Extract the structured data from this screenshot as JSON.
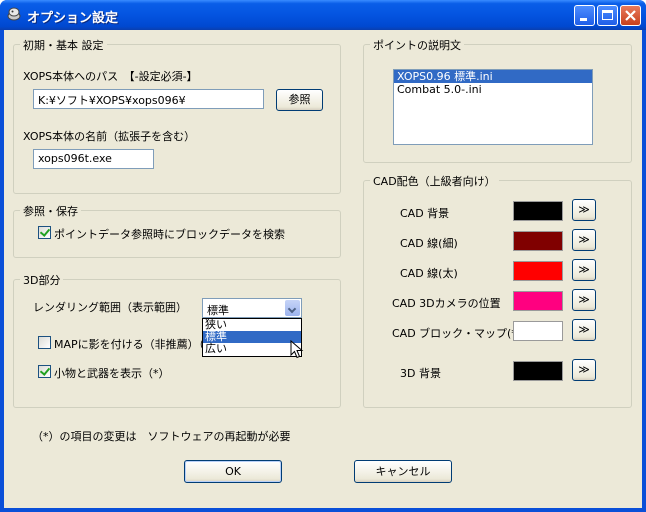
{
  "window": {
    "title": "オプション設定"
  },
  "groups": {
    "basic": {
      "title": "初期・基本 設定",
      "path_label": "XOPS本体へのパス　【-設定必須-】",
      "path_value": "K:¥ソフト¥XOPS¥xops096¥",
      "browse_button": "参照",
      "name_label": "XOPS本体の名前（拡張子を含む）",
      "name_value": "xops096t.exe"
    },
    "reference": {
      "title": "参照・保存",
      "search_block_label": "ポイントデータ参照時にブロックデータを検索",
      "search_block_checked": true
    },
    "threed": {
      "title": "3D部分",
      "range_label": "レンダリング範囲（表示範囲）",
      "range_selected": "標準",
      "range_options": [
        "狭い",
        "標準",
        "広い"
      ],
      "range_highlight": "標準",
      "shadow_label": "MAPに影を付ける（非推薦）（",
      "shadow_checked": false,
      "show_items_label": "小物と武器を表示（*）",
      "show_items_checked": true
    },
    "points": {
      "title": "ポイントの説明文",
      "items": [
        "XOPS0.96 標準.ini",
        "Combat 5.0-.ini"
      ],
      "selected": "XOPS0.96 標準.ini"
    },
    "cad": {
      "title": "CAD配色（上級者向け）",
      "rows": [
        {
          "label": "CAD 背景",
          "color": "#000000"
        },
        {
          "label": "CAD 線(細)",
          "color": "#800000"
        },
        {
          "label": "CAD 線(太)",
          "color": "#ff0000"
        },
        {
          "label": "CAD 3Dカメラの位置",
          "color": "#ff0080"
        },
        {
          "label": "CAD ブロック・マップ(*)",
          "color": "#ffffff"
        },
        {
          "label": "3D 背景",
          "color": "#000000"
        }
      ],
      "picker_button": "≫"
    }
  },
  "note": "（*）の項目の変更は　ソフトウェアの再起動が必要",
  "ok_button": "OK",
  "cancel_button": "キャンセル"
}
